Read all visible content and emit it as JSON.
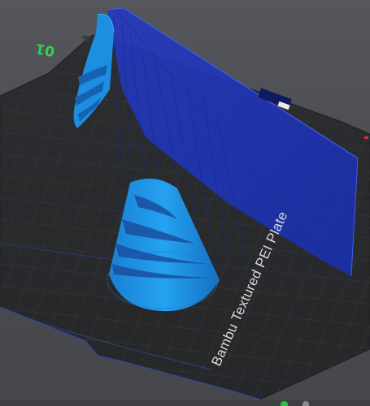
{
  "viewport": {
    "plate_number": "01",
    "plate_name": "Bambu Textured PEI Plate"
  },
  "colors": {
    "background": "#4b4d52",
    "plate": "#2a2b2e",
    "grid": "#3b3d42",
    "model_light": "#1f8fe3",
    "model_dark": "#1a5fa8",
    "support_plane": "#1d3ec4",
    "plate_number": "#2fd24a"
  },
  "icons": {
    "plate_label": "plate-number-badge",
    "status": "status-indicator-icon"
  }
}
